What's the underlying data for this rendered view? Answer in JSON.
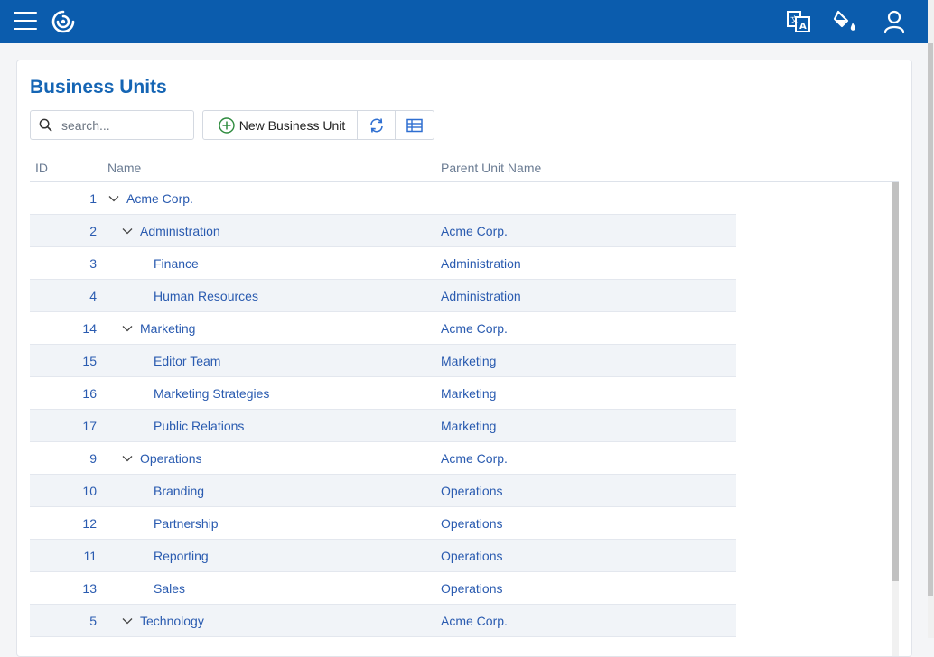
{
  "topbar": {
    "icons": [
      "menu-icon",
      "logo-icon",
      "translate-icon",
      "theme-paint-icon",
      "user-icon"
    ],
    "brand_color": "#0b5cad"
  },
  "page": {
    "title": "Business Units"
  },
  "toolbar": {
    "search_placeholder": "search...",
    "new_label": "New Business Unit",
    "refresh_icon": "refresh-icon",
    "columns_icon": "column-picker-icon"
  },
  "grid": {
    "headers": {
      "id": "ID",
      "name": "Name",
      "parent": "Parent Unit Name"
    },
    "rows": [
      {
        "id": "1",
        "name": "Acme Corp.",
        "parent": "",
        "level": 0,
        "expanded": true
      },
      {
        "id": "2",
        "name": "Administration",
        "parent": "Acme Corp.",
        "level": 1,
        "expanded": true
      },
      {
        "id": "3",
        "name": "Finance",
        "parent": "Administration",
        "level": 2
      },
      {
        "id": "4",
        "name": "Human Resources",
        "parent": "Administration",
        "level": 2
      },
      {
        "id": "14",
        "name": "Marketing",
        "parent": "Acme Corp.",
        "level": 1,
        "expanded": true
      },
      {
        "id": "15",
        "name": "Editor Team",
        "parent": "Marketing",
        "level": 2
      },
      {
        "id": "16",
        "name": "Marketing Strategies",
        "parent": "Marketing",
        "level": 2
      },
      {
        "id": "17",
        "name": "Public Relations",
        "parent": "Marketing",
        "level": 2
      },
      {
        "id": "9",
        "name": "Operations",
        "parent": "Acme Corp.",
        "level": 1,
        "expanded": true
      },
      {
        "id": "10",
        "name": "Branding",
        "parent": "Operations",
        "level": 2
      },
      {
        "id": "12",
        "name": "Partnership",
        "parent": "Operations",
        "level": 2
      },
      {
        "id": "11",
        "name": "Reporting",
        "parent": "Operations",
        "level": 2
      },
      {
        "id": "13",
        "name": "Sales",
        "parent": "Operations",
        "level": 2
      },
      {
        "id": "5",
        "name": "Technology",
        "parent": "Acme Corp.",
        "level": 1,
        "expanded": true
      }
    ]
  }
}
